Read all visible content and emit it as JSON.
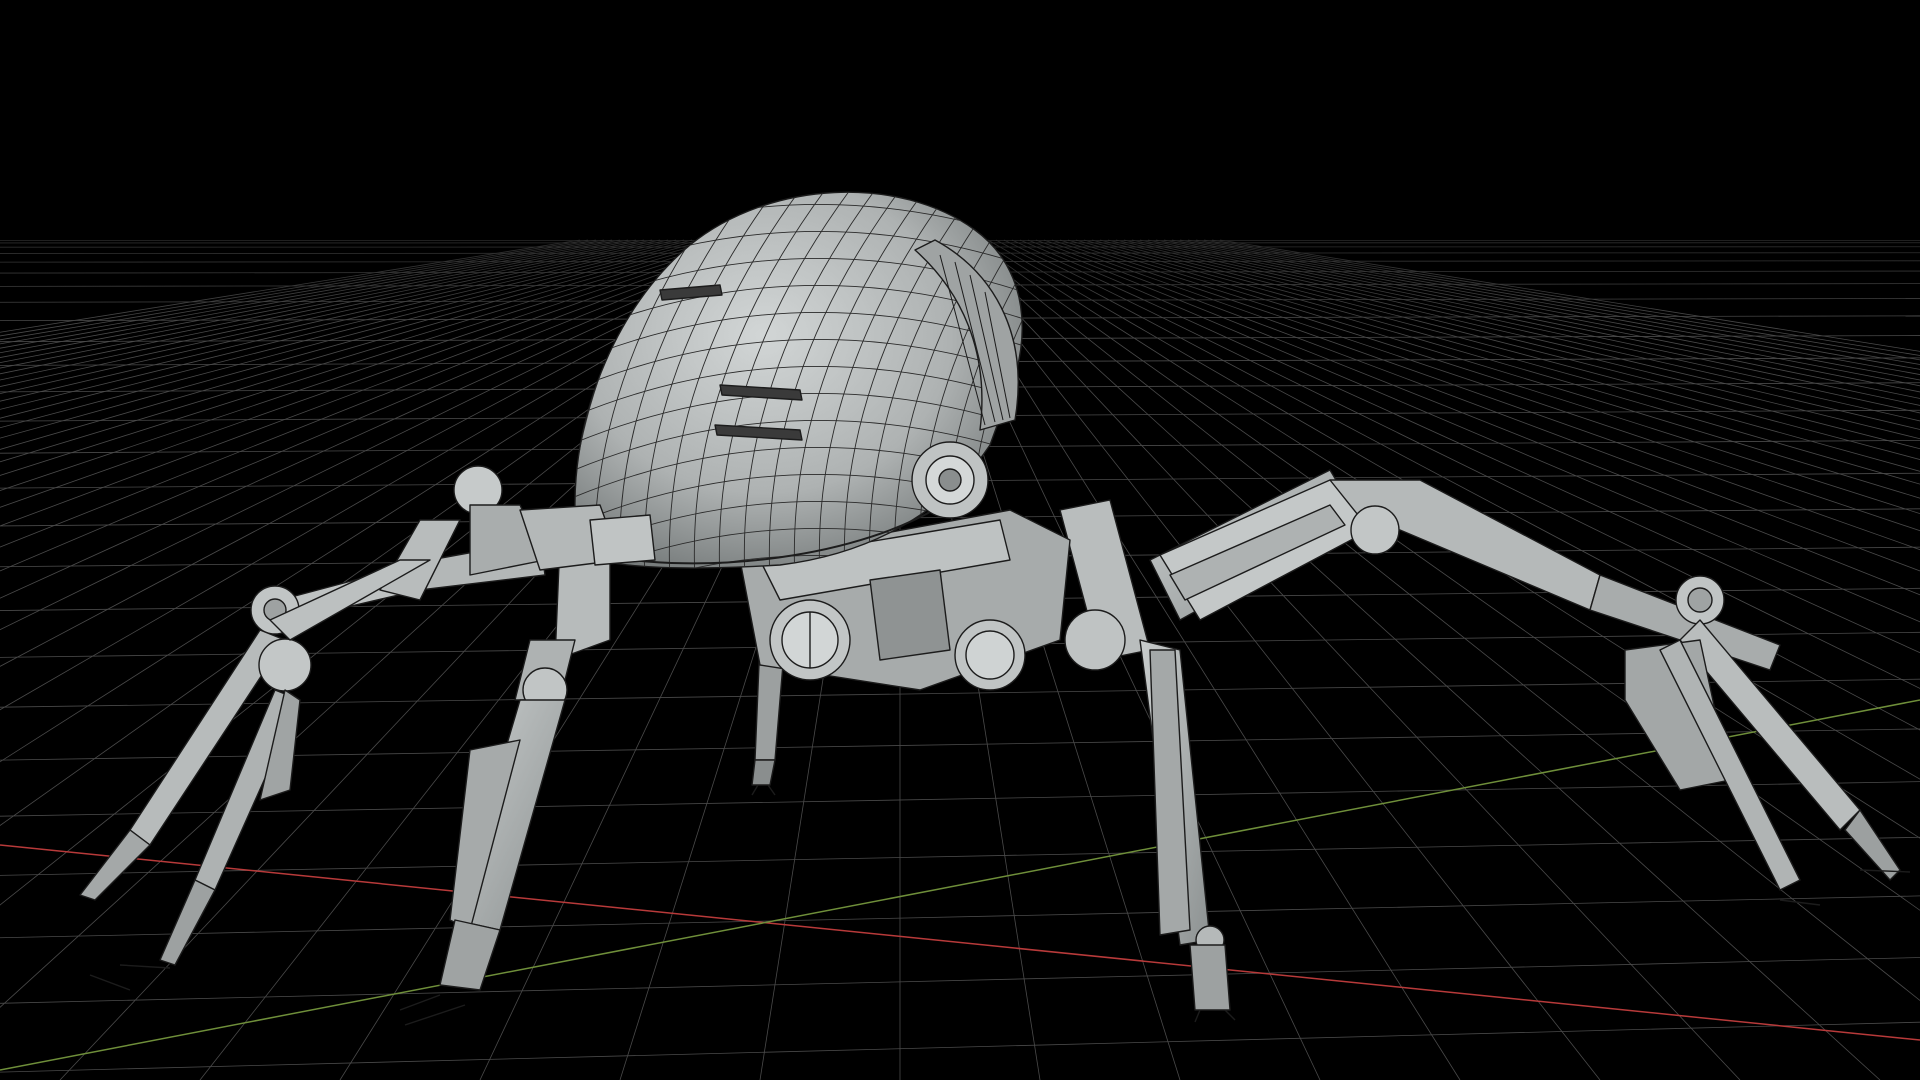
{
  "viewport": {
    "label": "",
    "background": "#000000",
    "shading_mode": "wireframe-on-shaded",
    "mesh_fill": "#b9bdbd",
    "mesh_shadow": "#7d8282",
    "wire_color": "#1c1c1c",
    "grid_color": "#4a4a4a"
  },
  "grid": {
    "visible": true,
    "x_axis_color": "#b83a3a",
    "z_axis_color": "#6f8f3a"
  },
  "model": {
    "subject": "mechanical-spider-robot",
    "parts": [
      "dome-body",
      "front-sensor-head",
      "left-front-leg",
      "left-back-leg",
      "center-left-leg",
      "center-right-leg",
      "right-back-leg",
      "right-front-leg",
      "rear-small-leg"
    ]
  }
}
